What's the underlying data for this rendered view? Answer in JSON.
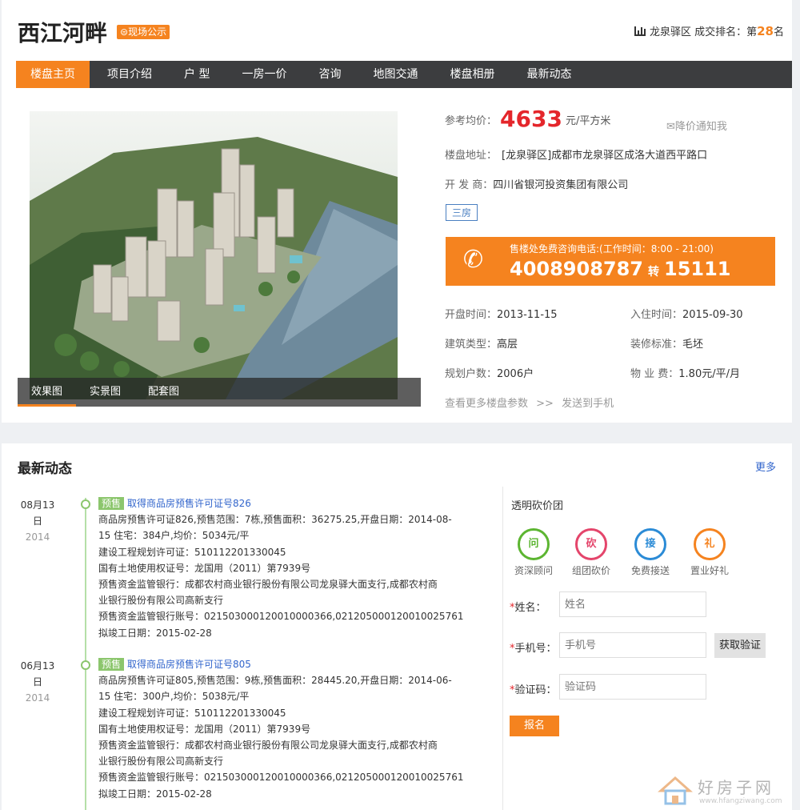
{
  "header": {
    "title": "西江河畔",
    "badge": "现场公示",
    "rank_prefix": "龙泉驿区 成交排名：第",
    "rank_num": "28",
    "rank_suffix": "名"
  },
  "nav": [
    "楼盘主页",
    "项目介绍",
    "户 型",
    "一房一价",
    "咨询",
    "地图交通",
    "楼盘相册",
    "最新动态"
  ],
  "image_tabs": [
    "效果图",
    "实景图",
    "配套图"
  ],
  "info": {
    "price_label": "参考均价：",
    "price_value": "4633",
    "price_unit": "元/平方米",
    "notify": "降价通知我",
    "address_label": "楼盘地址：",
    "address": "[龙泉驿区]成都市龙泉驿区成洛大道西平路口",
    "developer_label": "开 发 商：",
    "developer": "四川省银河投资集团有限公司",
    "tag": "三房",
    "hotline_note": "售楼处免费咨询电话:(工作时间：8:00 - 21:00)",
    "hotline_number": "4008908787",
    "hotline_ext_label": "转",
    "hotline_ext": "15111",
    "open_label": "开盘时间：",
    "open_date": "2013-11-15",
    "move_label": "入住时间：",
    "move_date": "2015-09-30",
    "type_label": "建筑类型：",
    "type": "高层",
    "deco_label": "装修标准：",
    "deco": "毛坯",
    "units_label": "规划户数：",
    "units": "2006户",
    "fee_label": "物 业 费：",
    "fee": "1.80元/平/月",
    "more_params": "查看更多楼盘参数",
    "sep": ">>",
    "send_phone": "发送到手机"
  },
  "news": {
    "title": "最新动态",
    "more": "更多",
    "items": [
      {
        "date_md": "08月13",
        "date_d": "日",
        "year": "2014",
        "tag": "预售",
        "headline": "取得商品房预售许可证号826",
        "lines": [
          "商品房预售许可证826,预售范围：7栋,预售面积：36275.25,开盘日期：2014-08-",
          "15 住宅：384户,均价：5034元/平",
          "建设工程规划许可证：510112201330045",
          "国有土地使用权证号：龙国用（2011）第7939号",
          "预售资金监管银行：成都农村商业银行股份有限公司龙泉驿大面支行,成都农村商",
          "业银行股份有限公司高新支行",
          "预售资金监管银行账号：021503000120010000366,021205000120010025761",
          "拟竣工日期：2015-02-28"
        ]
      },
      {
        "date_md": "06月13",
        "date_d": "日",
        "year": "2014",
        "tag": "预售",
        "headline": "取得商品房预售许可证号805",
        "lines": [
          "商品房预售许可证805,预售范围：9栋,预售面积：28445.20,开盘日期：2014-06-",
          "15 住宅：300户,均价：5038元/平",
          "建设工程规划许可证：510112201330045",
          "国有土地使用权证号：龙国用（2011）第7939号",
          "预售资金监管银行：成都农村商业银行股份有限公司龙泉驿大面支行,成都农村商",
          "业银行股份有限公司高新支行",
          "预售资金监管银行账号：021503000120010000366,021205000120010025761",
          "拟竣工日期：2015-02-28"
        ]
      }
    ]
  },
  "sidebar": {
    "title": "透明砍价团",
    "icons": [
      {
        "glyph": "问",
        "label": "资深顾问",
        "color": "#5cb531",
        "icon": "question-icon"
      },
      {
        "glyph": "砍",
        "label": "组团砍价",
        "color": "#e4456b",
        "icon": "bargain-icon"
      },
      {
        "glyph": "接",
        "label": "免费接送",
        "color": "#2b8bd6",
        "icon": "car-icon"
      },
      {
        "glyph": "礼",
        "label": "置业好礼",
        "color": "#f5831f",
        "icon": "gift-icon"
      }
    ],
    "name_label": "姓名：",
    "name_placeholder": "姓名",
    "phone_label": "手机号：",
    "phone_placeholder": "手机号",
    "code_label": "验证码：",
    "code_placeholder": "验证码",
    "get_code": "获取验证",
    "submit": "报名",
    "required_mark": "*"
  },
  "watermark": {
    "text": "好房子网",
    "url": "www.hfangziwang.com"
  },
  "colors": {
    "accent": "#f5831f",
    "nav_bg": "#3c3d3f",
    "price": "#e4262b",
    "link": "#3366cc",
    "timeline": "#8cc66d"
  }
}
